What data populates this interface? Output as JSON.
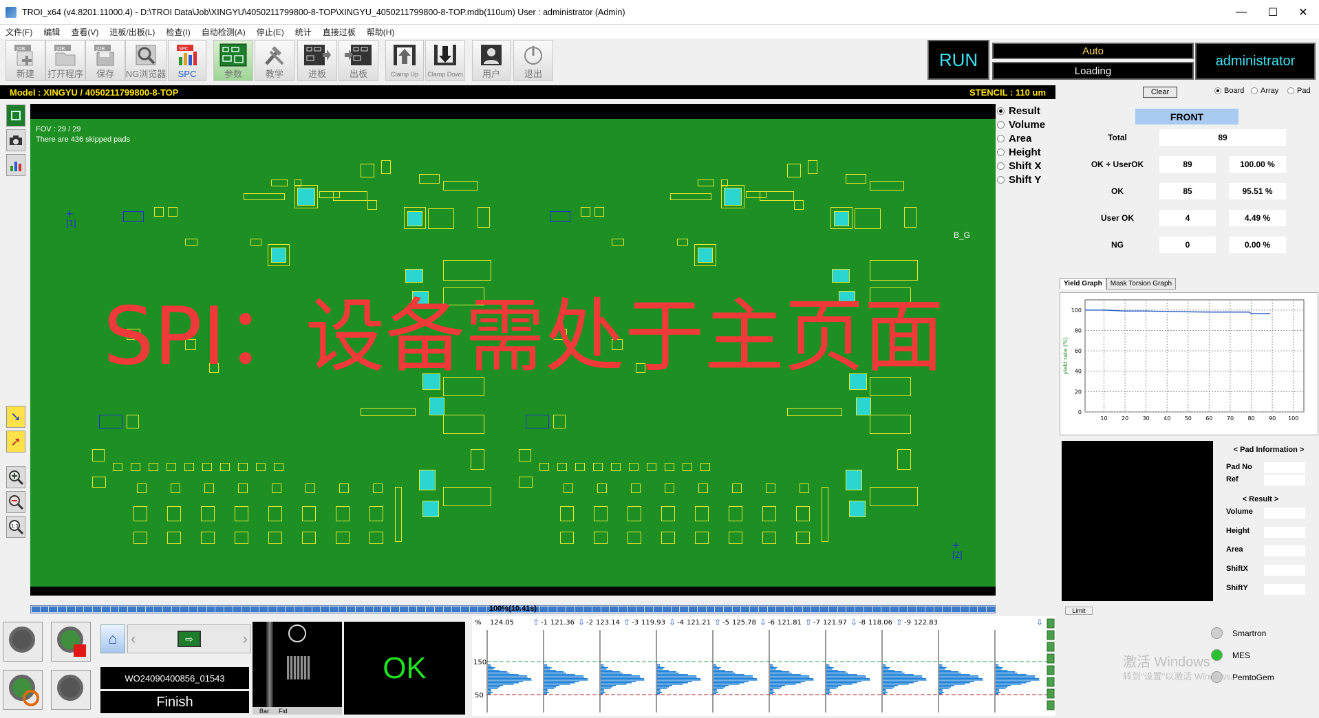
{
  "window": {
    "title": "TROI_x64 (v4.8201.11000.4) - D:\\TROI Data\\Job\\XINGYU\\4050211799800-8-TOP\\XINGYU_4050211799800-8-TOP.mdb(110um) User : administrator (Admin)",
    "controls": [
      "—",
      "☐",
      "✕"
    ]
  },
  "menu": [
    "文件(F)",
    "编辑",
    "查看(V)",
    "进板/出板(L)",
    "检查(I)",
    "自动检测(A)",
    "停止(E)",
    "统计",
    "直接过板",
    "帮助(H)"
  ],
  "toolbar": [
    {
      "label": "新建",
      "tag": "JOB",
      "icon": "new-job-icon"
    },
    {
      "label": "打开程序",
      "tag": "JOB",
      "icon": "open-job-icon"
    },
    {
      "label": "保存",
      "tag": "JOB",
      "icon": "save-job-icon"
    },
    {
      "label": "NG浏览器",
      "tag": "",
      "icon": "ng-browser-icon"
    },
    {
      "label": "SPC",
      "tag": "SPC",
      "icon": "spc-icon"
    },
    {
      "label": "参数",
      "tag": "",
      "icon": "parameter-icon"
    },
    {
      "label": "教学",
      "tag": "",
      "icon": "teach-icon"
    },
    {
      "label": "进板",
      "tag": "",
      "icon": "load-board-icon"
    },
    {
      "label": "出板",
      "tag": "",
      "icon": "unload-board-icon"
    },
    {
      "label": "Clamp Up",
      "tag": "",
      "icon": "clamp-up-icon"
    },
    {
      "label": "Clamp Down",
      "tag": "",
      "icon": "clamp-down-icon"
    },
    {
      "label": "用户",
      "tag": "",
      "icon": "user-icon"
    },
    {
      "label": "退出",
      "tag": "",
      "icon": "power-icon"
    }
  ],
  "status": {
    "run": "RUN",
    "mode": "Auto",
    "state": "Loading",
    "user": "administrator"
  },
  "model_bar": {
    "model": "Model : XINGYU / 4050211799800-8-TOP",
    "stencil": "STENCIL : 110 um"
  },
  "board_view": {
    "fov": "FOV : 29 / 29",
    "skipped": "There are 436 skipped pads",
    "marker1": "[1]",
    "marker2": "[2]",
    "side_label": "B_G",
    "overlay_text": "SPI：设备需处于主页面"
  },
  "view_options": {
    "items": [
      "Result",
      "Volume",
      "Area",
      "Height",
      "Shift X",
      "Shift Y"
    ],
    "selected": "Result"
  },
  "progress": {
    "text": "100%(10.41s)",
    "value": 1.0
  },
  "summary": {
    "clear_label": "Clear",
    "scope_options": [
      "Board",
      "Array",
      "Pad"
    ],
    "scope_selected": "Board",
    "side": "FRONT",
    "rows": [
      {
        "label": "Total",
        "count": "89",
        "percent": ""
      },
      {
        "label": "OK + UserOK",
        "count": "89",
        "percent": "100.00 %"
      },
      {
        "label": "OK",
        "count": "85",
        "percent": "95.51 %"
      },
      {
        "label": "User OK",
        "count": "4",
        "percent": "4.49 %"
      },
      {
        "label": "NG",
        "count": "0",
        "percent": "0.00 %"
      }
    ]
  },
  "graph_tabs": [
    "Yield Graph",
    "Mask Torsion Graph"
  ],
  "yield_graph": {
    "ylabel": "yield rate (%)",
    "yticks": [
      "0",
      "20",
      "40",
      "60",
      "80",
      "100"
    ],
    "xticks": [
      "10",
      "20",
      "30",
      "40",
      "50",
      "60",
      "70",
      "80",
      "90",
      "100"
    ]
  },
  "chart_data": {
    "type": "line",
    "x": [
      1,
      10,
      20,
      30,
      40,
      50,
      60,
      70,
      79,
      80,
      89
    ],
    "y": [
      100,
      100,
      99,
      99,
      98.5,
      98.3,
      98,
      98,
      98,
      96.5,
      96.5
    ],
    "ylabel": "yield rate (%)",
    "ylim": [
      0,
      110
    ],
    "xlim": [
      1,
      105
    ],
    "grid": true
  },
  "pad_info": {
    "heading": "< Pad Information >",
    "fields": [
      "Pad No",
      "Ref"
    ],
    "result_heading": "< Result >",
    "result_fields": [
      "Volume",
      "Height",
      "Area",
      "ShiftX",
      "ShiftY"
    ],
    "limit_label": "Limit"
  },
  "bottom": {
    "lot": "WO24090400856_01543",
    "state": "Finish",
    "result": "OK",
    "bar_labels": [
      "Bar",
      "Fid"
    ]
  },
  "histogram": {
    "header": [
      "%",
      "124.05",
      "-1",
      "121.36",
      "-2",
      "123.14",
      "-3",
      "119.93",
      "-4",
      "121.21",
      "-5",
      "125.78",
      "-6",
      "121.81",
      "-7",
      "121.97",
      "-8",
      "118.06",
      "-9",
      "122.83"
    ],
    "arrows": [
      "up",
      "down",
      "up",
      "down",
      "up",
      "down",
      "up",
      "down",
      "up",
      "down"
    ],
    "ylabels": [
      "150",
      "50"
    ],
    "colors": {
      "bar": "#1b7fd6",
      "upper": "#2fa84f",
      "lower": "#c0202a"
    }
  },
  "indicators": [
    {
      "label": "Smartron",
      "color": "#cfcfcf"
    },
    {
      "label": "MES",
      "color": "#27c22e"
    },
    {
      "label": "PemtoGem",
      "color": "#cfcfcf"
    }
  ],
  "watermark": {
    "line1": "激活 Windows",
    "line2": "转到\"设置\"以激活 Windows。"
  }
}
